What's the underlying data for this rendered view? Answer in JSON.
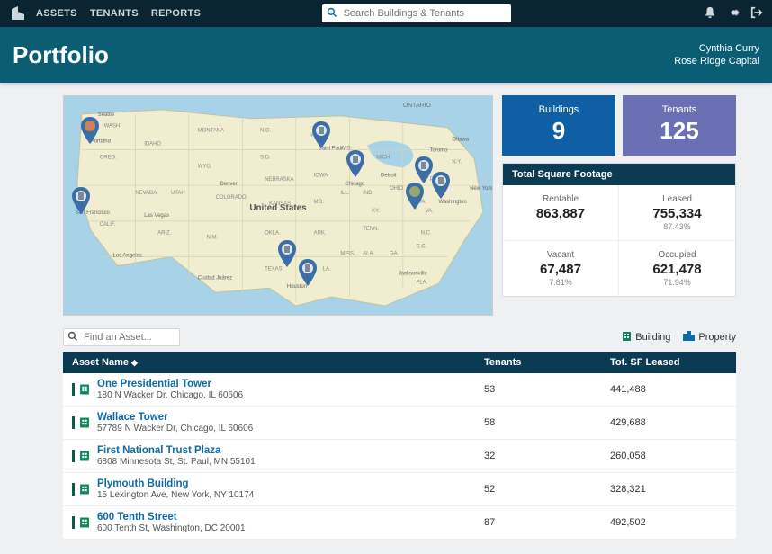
{
  "nav": {
    "items": [
      "ASSETS",
      "TENANTS",
      "REPORTS"
    ],
    "search_placeholder": "Search Buildings & Tenants"
  },
  "header": {
    "title": "Portfolio",
    "user_name": "Cynthia Curry",
    "company": "Rose Ridge Capital"
  },
  "stats": {
    "buildings_label": "Buildings",
    "buildings_value": "9",
    "tenants_label": "Tenants",
    "tenants_value": "125"
  },
  "sqft": {
    "title": "Total Square Footage",
    "cells": [
      {
        "label": "Rentable",
        "value": "863,887",
        "pct": ""
      },
      {
        "label": "Leased",
        "value": "755,334",
        "pct": "87.43%"
      },
      {
        "label": "Vacant",
        "value": "67,487",
        "pct": "7.81%"
      },
      {
        "label": "Occupied",
        "value": "621,478",
        "pct": "71.94%"
      }
    ]
  },
  "map": {
    "region_label": "United States",
    "neighbor_labels": [
      "ONTARIO"
    ],
    "state_labels": [
      "WASH.",
      "OREG.",
      "IDAHO",
      "MONTANA",
      "N.D.",
      "S.D.",
      "WYO.",
      "NEVADA",
      "UTAH",
      "COLORADO",
      "CALIF.",
      "ARIZ.",
      "N.M.",
      "KANSAS",
      "NEBRASKA",
      "IOWA",
      "MINN.",
      "WIS.",
      "MICH.",
      "OKLA.",
      "TEXAS",
      "ARK.",
      "MO.",
      "LA.",
      "MISS.",
      "ALA.",
      "GA.",
      "FLA.",
      "TENN.",
      "KY.",
      "ILL.",
      "IND.",
      "OHIO",
      "W.VA.",
      "VA.",
      "N.C.",
      "S.C.",
      "PA.",
      "N.Y."
    ],
    "city_labels": [
      "Seattle",
      "Portland",
      "San Francisco",
      "Los Angeles",
      "Las Vegas",
      "Denver",
      "Chicago",
      "Detroit",
      "Ottawa",
      "Toronto",
      "New York",
      "Washington",
      "Houston",
      "Jacksonville",
      "Ciudad Juárez",
      "Saint Paul"
    ]
  },
  "assets": {
    "find_placeholder": "Find an Asset...",
    "legend": {
      "building": "Building",
      "property": "Property"
    },
    "columns": {
      "name": "Asset Name",
      "tenants": "Tenants",
      "sf": "Tot. SF Leased"
    },
    "rows": [
      {
        "name": "One Presidential Tower",
        "addr": "180 N Wacker Dr, Chicago, IL 60606",
        "tenants": "53",
        "sf": "441,488"
      },
      {
        "name": "Wallace Tower",
        "addr": "57789 N Wacker Dr, Chicago, IL 60606",
        "tenants": "58",
        "sf": "429,688"
      },
      {
        "name": "First National Trust Plaza",
        "addr": "6808 Minnesota St, St. Paul, MN 55101",
        "tenants": "32",
        "sf": "260,058"
      },
      {
        "name": "Plymouth Building",
        "addr": "15 Lexington Ave, New York, NY 10174",
        "tenants": "52",
        "sf": "328,321"
      },
      {
        "name": "600 Tenth Street",
        "addr": "600 Tenth St, Washington, DC 20001",
        "tenants": "87",
        "sf": "492,502"
      }
    ]
  },
  "colors": {
    "accent_blue": "#0f5fa5",
    "accent_purple": "#6b70b5",
    "dark_header": "#0b3b52"
  }
}
